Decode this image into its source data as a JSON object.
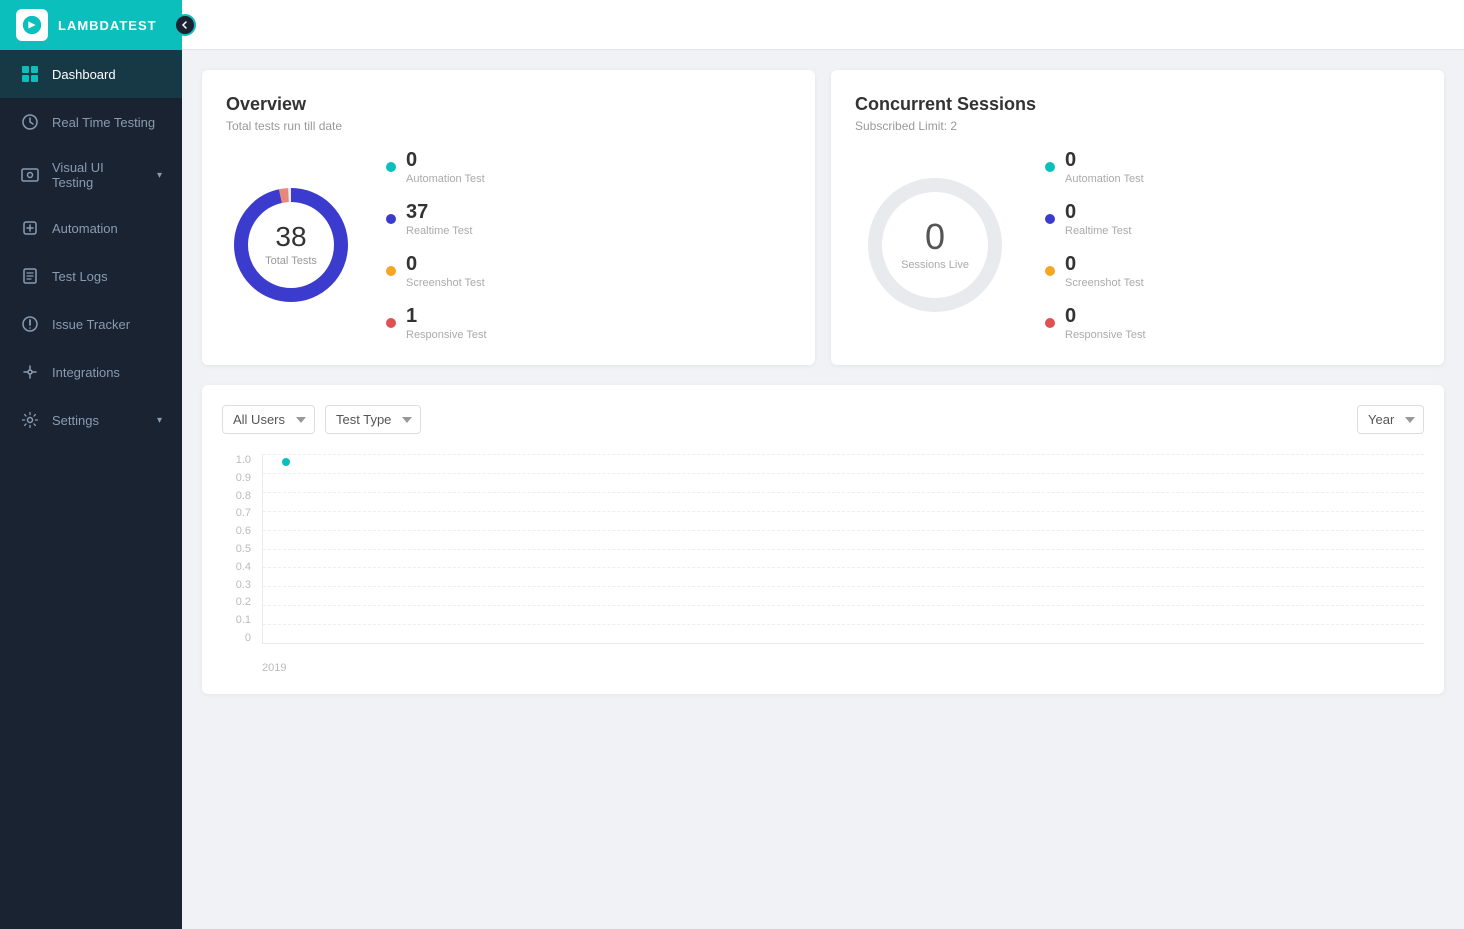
{
  "brand": {
    "name": "LAMBDATEST"
  },
  "sidebar": {
    "items": [
      {
        "id": "dashboard",
        "label": "Dashboard",
        "active": true,
        "icon": "dashboard-icon"
      },
      {
        "id": "real-time-testing",
        "label": "Real Time Testing",
        "active": false,
        "icon": "realtime-icon"
      },
      {
        "id": "visual-ui-testing",
        "label": "Visual UI Testing",
        "active": false,
        "icon": "visual-icon",
        "hasChevron": true
      },
      {
        "id": "automation",
        "label": "Automation",
        "active": false,
        "icon": "automation-icon"
      },
      {
        "id": "test-logs",
        "label": "Test Logs",
        "active": false,
        "icon": "testlogs-icon"
      },
      {
        "id": "issue-tracker",
        "label": "Issue Tracker",
        "active": false,
        "icon": "issue-icon"
      },
      {
        "id": "integrations",
        "label": "Integrations",
        "active": false,
        "icon": "integrations-icon"
      },
      {
        "id": "settings",
        "label": "Settings",
        "active": false,
        "icon": "settings-icon",
        "hasChevron": true
      }
    ]
  },
  "overview": {
    "title": "Overview",
    "subtitle": "Total tests run till date",
    "total_number": "38",
    "total_label": "Total Tests",
    "stats": [
      {
        "id": "automation",
        "value": "0",
        "label": "Automation Test",
        "color": "#0abfbc"
      },
      {
        "id": "realtime",
        "value": "37",
        "label": "Realtime Test",
        "color": "#3b3bce"
      },
      {
        "id": "screenshot",
        "value": "0",
        "label": "Screenshot Test",
        "color": "#f5a623"
      },
      {
        "id": "responsive",
        "value": "1",
        "label": "Responsive Test",
        "color": "#e05252"
      }
    ]
  },
  "concurrent": {
    "title": "Concurrent Sessions",
    "subtitle": "Subscribed Limit: 2",
    "sessions_number": "0",
    "sessions_label": "Sessions Live",
    "stats": [
      {
        "id": "automation",
        "value": "0",
        "label": "Automation Test",
        "color": "#0abfbc"
      },
      {
        "id": "realtime",
        "value": "0",
        "label": "Realtime Test",
        "color": "#3b3bce"
      },
      {
        "id": "screenshot",
        "value": "0",
        "label": "Screenshot Test",
        "color": "#f5a623"
      },
      {
        "id": "responsive",
        "value": "0",
        "label": "Responsive Test",
        "color": "#e05252"
      }
    ]
  },
  "chart": {
    "filter_users_label": "All Users",
    "filter_test_type_label": "Test Type",
    "filter_period_label": "Year",
    "y_labels": [
      "1.0",
      "0.9",
      "0.8",
      "0.7",
      "0.6",
      "0.5",
      "0.4",
      "0.3",
      "0.2",
      "0.1",
      "0"
    ],
    "x_label": "2019",
    "dot_x_percent": 2,
    "dot_y_percent": 0
  },
  "colors": {
    "teal": "#0abfbc",
    "navy": "#1a2332",
    "purple": "#3b3bce",
    "orange": "#f5a623",
    "red": "#e05252",
    "light_gray_ring": "#e8eaed"
  }
}
